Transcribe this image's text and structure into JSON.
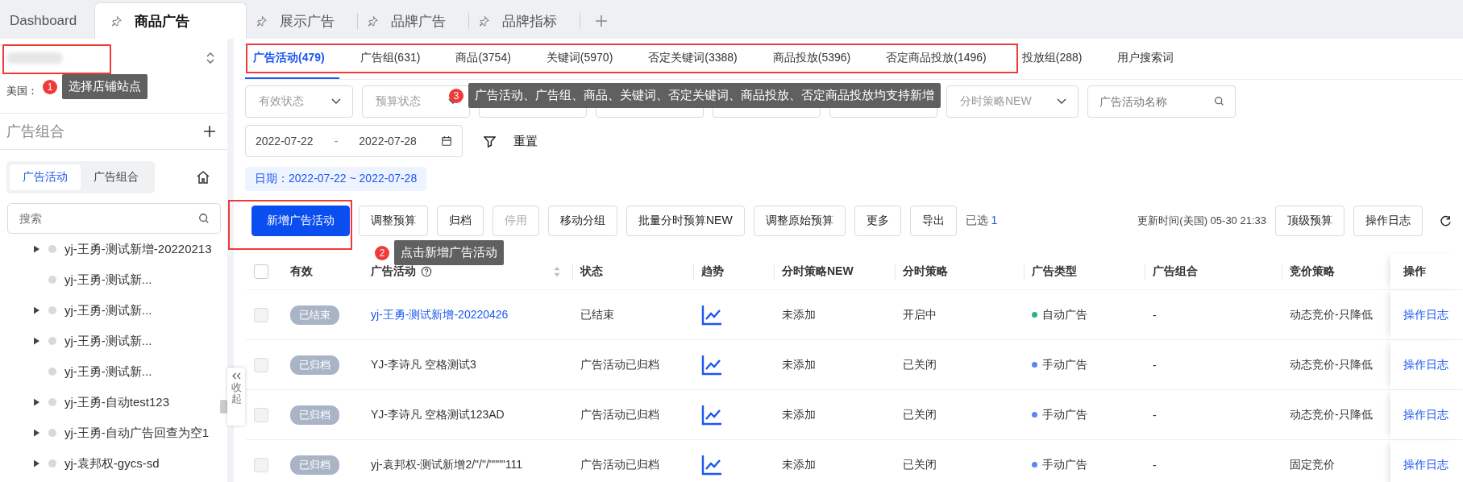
{
  "app_tabs": [
    {
      "label": "Dashboard",
      "pinned": false,
      "selected": false
    },
    {
      "label": "商品广告",
      "pinned": true,
      "selected": true
    },
    {
      "label": "展示广告",
      "pinned": true,
      "selected": false
    },
    {
      "label": "品牌广告",
      "pinned": true,
      "selected": false
    },
    {
      "label": "品牌指标",
      "pinned": true,
      "selected": false
    }
  ],
  "sidebar": {
    "region_time": "美国：",
    "group_title": "广告组合",
    "segments": [
      {
        "label": "广告活动",
        "selected": true
      },
      {
        "label": "广告组合",
        "selected": false
      }
    ],
    "search": {
      "placeholder": "搜索"
    },
    "tree": [
      {
        "label": "yj-王勇-测试新增-20220213",
        "expandable": true
      },
      {
        "label": "yj-王勇-测试新...",
        "expandable": false
      },
      {
        "label": "yj-王勇-测试新...",
        "expandable": true
      },
      {
        "label": "yj-王勇-测试新...",
        "expandable": true
      },
      {
        "label": "yj-王勇-测试新...",
        "expandable": false
      },
      {
        "label": "yj-王勇-自动test123",
        "expandable": true
      },
      {
        "label": "yj-王勇-自动广告回查为空1",
        "expandable": true
      },
      {
        "label": "yj-袁邦权-gycs-sd",
        "expandable": true
      }
    ],
    "collapse_label": "收起"
  },
  "main": {
    "tabs": [
      {
        "label": "广告活动(479)",
        "selected": true
      },
      {
        "label": "广告组(631)",
        "selected": false
      },
      {
        "label": "商品(3754)",
        "selected": false
      },
      {
        "label": "关键词(5970)",
        "selected": false
      },
      {
        "label": "否定关键词(3388)",
        "selected": false
      },
      {
        "label": "商品投放(5396)",
        "selected": false
      },
      {
        "label": "否定商品投放(1496)",
        "selected": false
      },
      {
        "label": "投放组(288)",
        "selected": false
      },
      {
        "label": "用户搜索词",
        "selected": false
      }
    ],
    "filters": [
      {
        "kind": "select",
        "placeholder": "有效状态"
      },
      {
        "kind": "select",
        "placeholder": "预算状态"
      },
      {
        "kind": "select"
      },
      {
        "kind": "select"
      },
      {
        "kind": "select"
      },
      {
        "kind": "select"
      },
      {
        "kind": "select",
        "placeholder": "分时策略NEW"
      },
      {
        "kind": "search",
        "placeholder": "广告活动名称"
      }
    ],
    "date_range": {
      "start": "2022-07-22",
      "separator": "-",
      "end": "2022-07-28"
    },
    "reset": "重置",
    "date_tag": "日期：2022-07-22 ~ 2022-07-28",
    "buttons": [
      {
        "label": "新增广告活动",
        "kind": "primary",
        "disabled": false
      },
      {
        "label": "调整预算",
        "kind": "default",
        "disabled": false
      },
      {
        "label": "归档",
        "kind": "default",
        "disabled": false
      },
      {
        "label": "停用",
        "kind": "default",
        "disabled": true
      },
      {
        "label": "移动分组",
        "kind": "default",
        "disabled": false
      },
      {
        "label": "批量分时预算NEW",
        "kind": "default",
        "disabled": false
      },
      {
        "label": "调整原始预算",
        "kind": "default",
        "disabled": false
      },
      {
        "label": "更多",
        "kind": "default",
        "disabled": false
      },
      {
        "label": "导出",
        "kind": "default",
        "disabled": false
      }
    ],
    "selected_label": "已选",
    "selected_count": "1",
    "update_time": "更新时间(美国) 05-30 21:33",
    "right_buttons": [
      "顶级预算",
      "操作日志"
    ],
    "table": {
      "all_checked": false,
      "columns": [
        "有效",
        "广告活动",
        "状态",
        "趋势",
        "分时策略NEW",
        "分时策略",
        "广告类型",
        "广告组合",
        "竞价策略",
        "操作"
      ],
      "rows": [
        {
          "valid": "已结束",
          "name": "yj-王勇-测试新增-20220426",
          "link": true,
          "state": "已结束",
          "schedule_new": "未添加",
          "schedule": "开启中",
          "ad_type": "自动广告",
          "color": "#2bb08a",
          "group": "-",
          "bidding": "动态竞价-只降低",
          "action": "操作日志",
          "disabled": true
        },
        {
          "valid": "已归档",
          "name": "YJ-李诗凡 空格测试3",
          "link": false,
          "state": "广告活动已归档",
          "schedule_new": "未添加",
          "schedule": "已关闭",
          "ad_type": "手动广告",
          "color": "#5b84f5",
          "group": "-",
          "bidding": "动态竞价-只降低",
          "action": "操作日志",
          "disabled": true
        },
        {
          "valid": "已归档",
          "name": "YJ-李诗凡 空格测试123AD",
          "link": false,
          "state": "广告活动已归档",
          "schedule_new": "未添加",
          "schedule": "已关闭",
          "ad_type": "手动广告",
          "color": "#5b84f5",
          "group": "-",
          "bidding": "动态竞价-只降低",
          "action": "操作日志",
          "disabled": true
        },
        {
          "valid": "已归档",
          "name": "yj-袁邦权-测试新增2/\"/\"/\"\"\"\"111",
          "link": false,
          "state": "广告活动已归档",
          "schedule_new": "未添加",
          "schedule": "已关闭",
          "ad_type": "手动广告",
          "color": "#5b84f5",
          "group": "-",
          "bidding": "固定竞价",
          "action": "操作日志",
          "disabled": true
        }
      ]
    }
  },
  "annotations": [
    {
      "number": "1",
      "text": "选择店铺站点"
    },
    {
      "number": "2",
      "text": "点击新增广告活动"
    },
    {
      "number": "3",
      "text": "广告活动、广告组、商品、关键词、否定关键词、商品投放、否定商品投放均支持新增"
    }
  ]
}
